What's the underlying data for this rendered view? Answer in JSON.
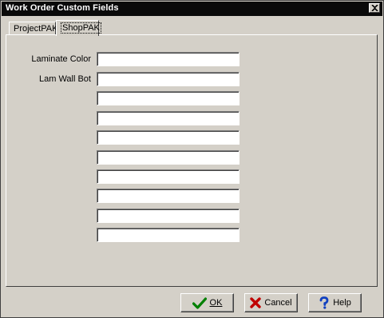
{
  "window": {
    "title": "Work Order Custom Fields"
  },
  "tabs": [
    {
      "label": "ProjectPAK",
      "active": false
    },
    {
      "label": "ShopPAK",
      "active": true
    }
  ],
  "fields": [
    {
      "label": "Laminate Color",
      "value": ""
    },
    {
      "label": "Lam Wall Bot",
      "value": ""
    },
    {
      "label": "",
      "value": ""
    },
    {
      "label": "",
      "value": ""
    },
    {
      "label": "",
      "value": ""
    },
    {
      "label": "",
      "value": ""
    },
    {
      "label": "",
      "value": ""
    },
    {
      "label": "",
      "value": ""
    },
    {
      "label": "",
      "value": ""
    },
    {
      "label": "",
      "value": ""
    }
  ],
  "buttons": {
    "ok": {
      "label": "OK",
      "icon": "checkmark-icon",
      "color": "#008000"
    },
    "cancel": {
      "label": "Cancel",
      "icon": "x-mark-icon",
      "color": "#c00000"
    },
    "help": {
      "label": "Help",
      "icon": "question-mark-icon",
      "color": "#1040c0"
    }
  }
}
